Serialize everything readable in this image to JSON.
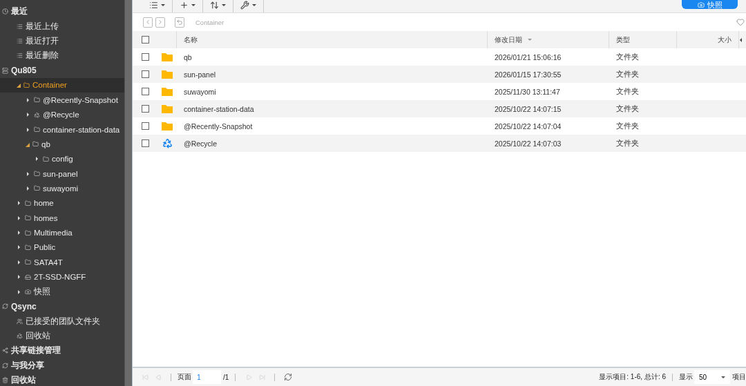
{
  "sidebar": {
    "sections": [
      {
        "label": "最近",
        "kind": "clock",
        "children": [
          {
            "label": "最近上传",
            "kind": "list"
          },
          {
            "label": "最近打开",
            "kind": "list"
          },
          {
            "label": "最近删除",
            "kind": "list"
          }
        ]
      },
      {
        "label": "Qu805",
        "kind": "server",
        "children": [
          {
            "label": "Container",
            "kind": "folder",
            "expanded": true,
            "selected": true,
            "children": [
              {
                "label": "@Recently-Snapshot",
                "kind": "folder",
                "expanded": false,
                "selected": false
              },
              {
                "label": "@Recycle",
                "kind": "recycle",
                "expanded": false,
                "selected": false
              },
              {
                "label": "container-station-data",
                "kind": "folder",
                "expanded": false,
                "selected": false
              },
              {
                "label": "qb",
                "kind": "folder",
                "expanded": true,
                "selected": false,
                "children": [
                  {
                    "label": "config",
                    "kind": "folder",
                    "expanded": false,
                    "selected": false
                  }
                ]
              },
              {
                "label": "sun-panel",
                "kind": "folder",
                "expanded": false,
                "selected": false
              },
              {
                "label": "suwayomi",
                "kind": "folder",
                "expanded": false,
                "selected": false
              }
            ]
          },
          {
            "label": "home",
            "kind": "folder",
            "expanded": false,
            "selected": false
          },
          {
            "label": "homes",
            "kind": "folder",
            "expanded": false,
            "selected": false
          },
          {
            "label": "Multimedia",
            "kind": "folder",
            "expanded": false,
            "selected": false
          },
          {
            "label": "Public",
            "kind": "folder",
            "expanded": false,
            "selected": false
          },
          {
            "label": "SATA4T",
            "kind": "folder",
            "expanded": false,
            "selected": false
          },
          {
            "label": "2T-SSD-NGFF",
            "kind": "drive",
            "expanded": false,
            "selected": false
          },
          {
            "label": "快照",
            "kind": "snapshot",
            "expanded": false,
            "selected": false
          }
        ]
      },
      {
        "label": "Qsync",
        "kind": "sync",
        "children": [
          {
            "label": "已接受的团队文件夹",
            "kind": "team"
          },
          {
            "label": "回收站",
            "kind": "recycle"
          }
        ]
      },
      {
        "label": "共享链接管理",
        "kind": "share"
      },
      {
        "label": "与我分享",
        "kind": "sharedwithme"
      },
      {
        "label": "回收站",
        "kind": "trash"
      }
    ]
  },
  "toolbar": {
    "snapshot_button": "快照"
  },
  "breadcrumb": {
    "path": "Container"
  },
  "table": {
    "select_all": false,
    "columns": [
      {
        "label": "名称",
        "sorted": false
      },
      {
        "label": "修改日期",
        "sorted": true
      },
      {
        "label": "类型",
        "sorted": false
      },
      {
        "label": "大小",
        "sorted": false
      }
    ],
    "rows": [
      {
        "name": "qb",
        "kind": "folder",
        "modified": "2026/01/21 15:06:16",
        "type": "文件夹",
        "checked": false
      },
      {
        "name": "sun-panel",
        "kind": "folder",
        "modified": "2026/01/15 17:30:55",
        "type": "文件夹",
        "checked": false
      },
      {
        "name": "suwayomi",
        "kind": "folder",
        "modified": "2025/11/30 13:11:47",
        "type": "文件夹",
        "checked": false
      },
      {
        "name": "container-station-data",
        "kind": "folder",
        "modified": "2025/10/22 14:07:15",
        "type": "文件夹",
        "checked": false
      },
      {
        "name": "@Recently-Snapshot",
        "kind": "folder",
        "modified": "2025/10/22 14:07:04",
        "type": "文件夹",
        "checked": false
      },
      {
        "name": "@Recycle",
        "kind": "recycle",
        "modified": "2025/10/22 14:07:03",
        "type": "文件夹",
        "checked": false
      }
    ]
  },
  "pager": {
    "page_label": "页面",
    "page": "1",
    "total_pages": "/1",
    "summary": "显示项目: 1-6, 总计: 6",
    "show_label": "显示",
    "page_size": "50",
    "items_label": "项目"
  }
}
